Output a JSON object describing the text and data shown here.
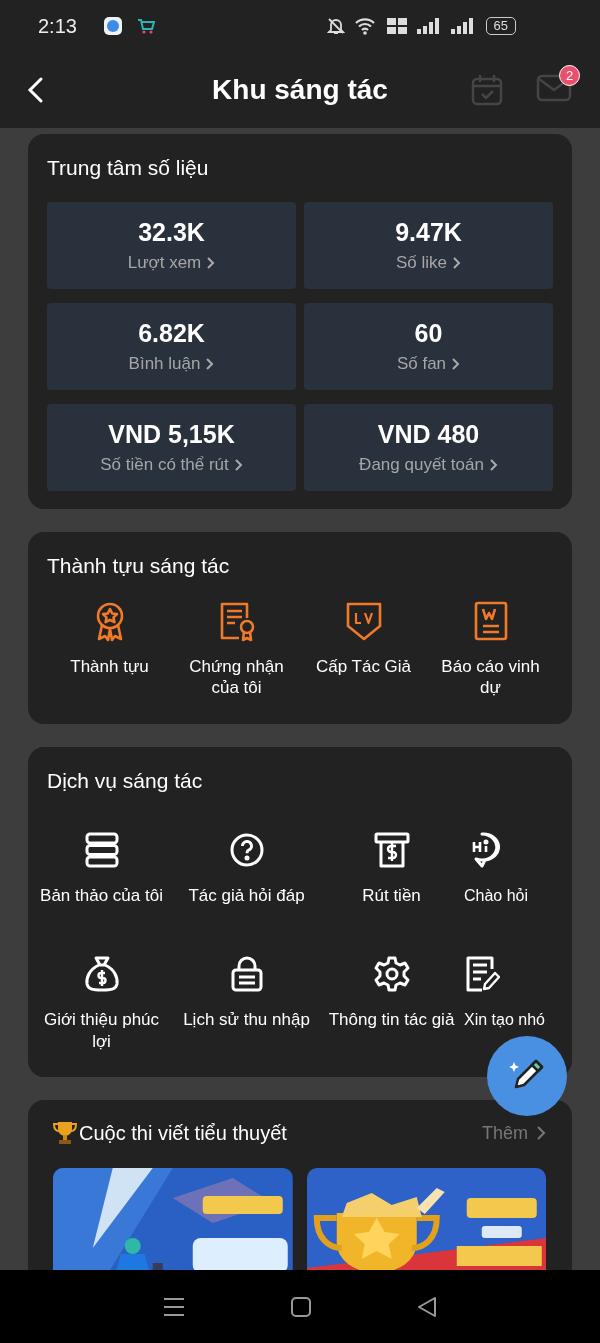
{
  "status_bar": {
    "time": "2:13",
    "battery": "65"
  },
  "header": {
    "title": "Khu sáng tác",
    "mail_badge": "2"
  },
  "data_center": {
    "title": "Trung tâm số liệu",
    "stats": [
      {
        "value": "32.3K",
        "label": "Lượt xem"
      },
      {
        "value": "9.47K",
        "label": "Số like"
      },
      {
        "value": "6.82K",
        "label": "Bình luận"
      },
      {
        "value": "60",
        "label": "Số fan"
      },
      {
        "value": "VND 5,15K",
        "label": "Số tiền có thể rút"
      },
      {
        "value": "VND 480",
        "label": "Đang quyết toán"
      }
    ]
  },
  "achievements": {
    "title": "Thành tựu sáng tác",
    "items": [
      {
        "kind": "medal",
        "label": "Thành tựu"
      },
      {
        "kind": "certificate",
        "label": "Chứng nhận của tôi"
      },
      {
        "kind": "level",
        "label": "Cấp Tác Giả"
      },
      {
        "kind": "report",
        "label": "Báo cáo vinh dự"
      }
    ]
  },
  "services": {
    "title": "Dịch vụ sáng tác",
    "items": [
      {
        "kind": "drafts",
        "label": "Bản thảo của tôi"
      },
      {
        "kind": "help",
        "label": "Tác giả hỏi đáp"
      },
      {
        "kind": "withdraw",
        "label": "Rút tiền"
      },
      {
        "kind": "greeting",
        "label": "Chào hỏi"
      },
      {
        "kind": "moneybag",
        "label": "Giới thiệu phúc lợi"
      },
      {
        "kind": "lock",
        "label": "Lịch sử thu nhập"
      },
      {
        "kind": "settings",
        "label": "Thông tin tác giả"
      },
      {
        "kind": "note",
        "label": "Xin tạo nhó"
      }
    ]
  },
  "contest": {
    "title": "Cuộc thi viết tiểu thuyết",
    "more": "Thêm"
  }
}
